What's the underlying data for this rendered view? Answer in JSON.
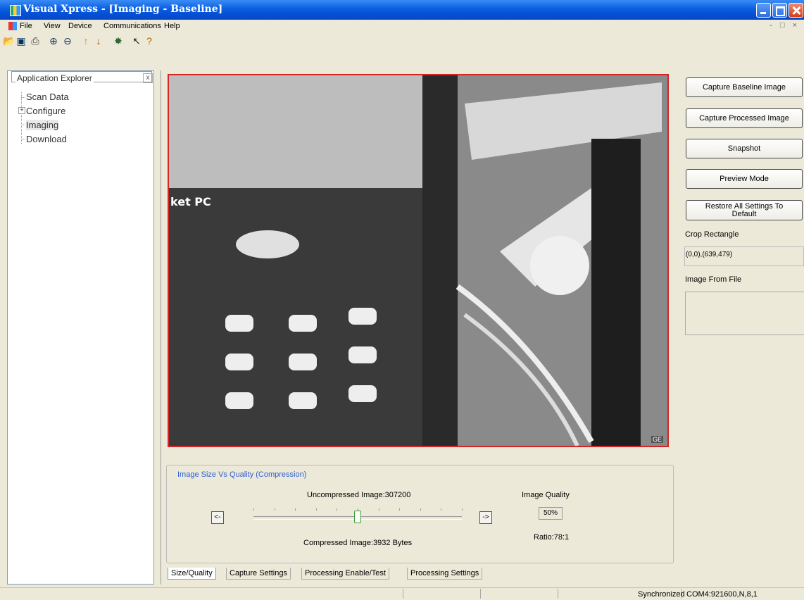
{
  "window": {
    "title": "Visual Xpress - [Imaging - Baseline]"
  },
  "menu": [
    "File",
    "View",
    "Device",
    "Communications",
    "Help"
  ],
  "toolbar_icons": [
    "open-icon",
    "save-icon",
    "print-icon",
    "zoom-in-icon",
    "zoom-out-icon",
    "upload-icon",
    "download-icon",
    "wizard-icon",
    "context-help-icon",
    "help-icon"
  ],
  "explorer": {
    "title": "Application Explorer",
    "close": "x",
    "items": [
      {
        "label": "Scan Data"
      },
      {
        "label": "Configure",
        "expandable": true
      },
      {
        "label": "Imaging",
        "selected": true
      },
      {
        "label": "Download"
      }
    ]
  },
  "compression": {
    "title": "Image Size Vs Quality (Compression)",
    "uncompressed": "Uncompressed Image:307200",
    "compressed": "Compressed Image:3932 Bytes",
    "quality_label": "Image Quality",
    "quality_value": "50%",
    "quality_level": 50,
    "ratio": "Ratio:78:1",
    "left_btn": "<-",
    "right_btn": "->"
  },
  "tabs": [
    "Size/Quality",
    "Capture Settings",
    "Processing Enable/Test",
    "Processing Settings"
  ],
  "actions": {
    "capture_baseline": "Capture Baseline Image",
    "capture_processed": "Capture Processed Image",
    "snapshot": "Snapshot",
    "preview": "Preview Mode",
    "restore": "Restore All Settings To Default"
  },
  "crop": {
    "label": "Crop Rectangle",
    "value": "(0,0),(639,479)"
  },
  "image_from_file": {
    "label": "Image From File"
  },
  "status": {
    "sync": "Synchronized",
    "port": "COM4:921600,N,8,1"
  },
  "colors": {
    "titlebar": "#0b5fe0",
    "frame_border": "#d42626",
    "panel_title": "#2a5fd4"
  }
}
